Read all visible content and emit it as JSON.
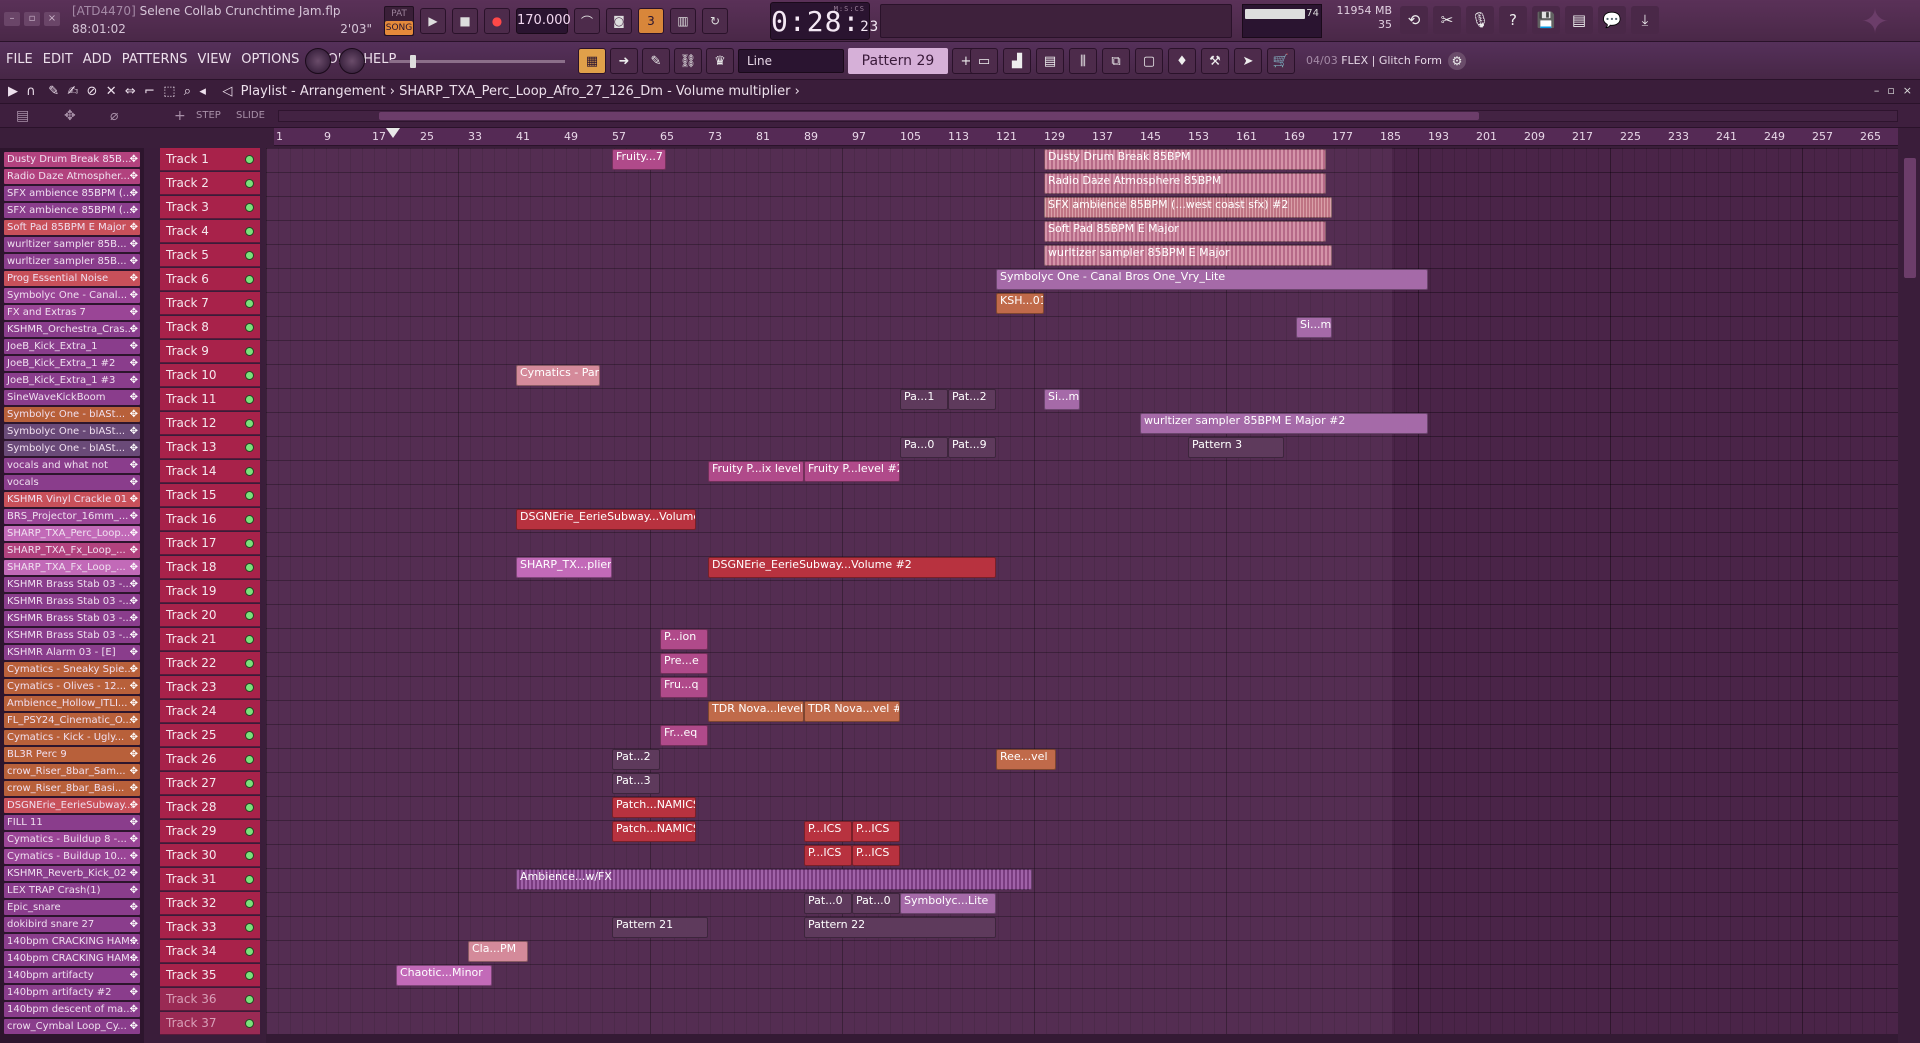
{
  "window": {
    "tag": "[ATD4470]",
    "filename": "Selene Collab Crunchtime Jam.flp",
    "position": "88:01:02",
    "duration": "2'03\""
  },
  "transport": {
    "pat_label": "PAT",
    "song_label": "SONG",
    "tempo": "170.000",
    "time_main": "0:28",
    "time_sub": "23",
    "time_unit": "M:S:CS"
  },
  "status": {
    "meter_value": "74",
    "memory": "11954 MB",
    "cpu_count": "35"
  },
  "menu": [
    "FILE",
    "EDIT",
    "ADD",
    "PATTERNS",
    "VIEW",
    "OPTIONS",
    "TOOLS",
    "HELP"
  ],
  "snap": "Line",
  "pattern": "Pattern 29",
  "hint": {
    "counter": "04/03",
    "text": "FLEX | Glitch Form"
  },
  "playlist": {
    "title": "Playlist - Arrangement",
    "sep": "›",
    "clip": "SHARP_TXA_Perc_Loop_Afro_27_126_Dm - Volume multiplier"
  },
  "ruler": [
    "1",
    "9",
    "17",
    "25",
    "33",
    "41",
    "49",
    "57",
    "65",
    "73",
    "81",
    "89",
    "97",
    "105",
    "113",
    "121",
    "129",
    "137",
    "145",
    "153",
    "161",
    "169",
    "177",
    "185",
    "193",
    "201",
    "209",
    "217",
    "225",
    "233",
    "241",
    "249",
    "257",
    "265"
  ],
  "step_label": "STEP",
  "slide_label": "SLIDE",
  "channels": [
    {
      "name": "Dusty Drum Break 85B...",
      "color": "#b2427e"
    },
    {
      "name": "Radio Daze Atmospher...",
      "color": "#b2427e"
    },
    {
      "name": "SFX ambience 85BPM (...",
      "color": "#8a3d8c"
    },
    {
      "name": "SFX ambience 85BPM (...",
      "color": "#8a3d8c"
    },
    {
      "name": "Soft Pad 85BPM E Major",
      "color": "#c8505a"
    },
    {
      "name": "wurltizer sampler 85B...",
      "color": "#8a3d8c"
    },
    {
      "name": "wurltizer sampler 85B...",
      "color": "#8a3d8c"
    },
    {
      "name": "Prog Essential Noise",
      "color": "#c8505a"
    },
    {
      "name": "Symbolyc One - Canal...",
      "color": "#9a4596"
    },
    {
      "name": "FX and Extras 7",
      "color": "#9a4596"
    },
    {
      "name": "KSHMR_Orchestra_Cras...",
      "color": "#8a3d8c"
    },
    {
      "name": "JoeB_Kick_Extra_1",
      "color": "#8a3d8c"
    },
    {
      "name": "JoeB_Kick_Extra_1 #2",
      "color": "#8a3d8c"
    },
    {
      "name": "JoeB_Kick_Extra_1 #3",
      "color": "#8a3d8c"
    },
    {
      "name": "SineWaveKickBoom",
      "color": "#8a3d8c"
    },
    {
      "name": "Symbolyc One - bIASt...",
      "color": "#b8603a"
    },
    {
      "name": "Symbolyc One - bIASt...",
      "color": "#6a4a78"
    },
    {
      "name": "Symbolyc One - bIASt...",
      "color": "#6a4a78"
    },
    {
      "name": "vocals and what not",
      "color": "#8a3d8c"
    },
    {
      "name": "vocals",
      "color": "#8a3d8c"
    },
    {
      "name": "KSHMR Vinyl Crackle 01",
      "color": "#c8505a"
    },
    {
      "name": "BRS_Projector_16mm_...",
      "color": "#9a4596"
    },
    {
      "name": "SHARP_TXA_Perc_Loop...",
      "color": "#c26ab8"
    },
    {
      "name": "SHARP_TXA_Fx_Loop_...",
      "color": "#b2427e"
    },
    {
      "name": "SHARP_TXA_Fx_Loop_...",
      "color": "#c26ab8"
    },
    {
      "name": "KSHMR Brass Stab 03 -...",
      "color": "#8a3d8c"
    },
    {
      "name": "KSHMR Brass Stab 03 -...",
      "color": "#8a3d8c"
    },
    {
      "name": "KSHMR Brass Stab 03 -...",
      "color": "#8a3d8c"
    },
    {
      "name": "KSHMR Brass Stab 03 -...",
      "color": "#8a3d8c"
    },
    {
      "name": "KSHMR Alarm 03 - [E]",
      "color": "#8a3d8c"
    },
    {
      "name": "Cymatics - Sneaky Spie...",
      "color": "#b8603a"
    },
    {
      "name": "Cymatics - Olives - 12...",
      "color": "#b8603a"
    },
    {
      "name": "Ambience_Hollow_ITLI...",
      "color": "#b8603a"
    },
    {
      "name": "FL_PSY24_Cinematic_O...",
      "color": "#b8603a"
    },
    {
      "name": "Cymatics - Kick - Ugly...",
      "color": "#b8603a"
    },
    {
      "name": "BL3R Perc 9",
      "color": "#b8603a"
    },
    {
      "name": "crow_Riser_8bar_Sam...",
      "color": "#b8603a"
    },
    {
      "name": "crow_Riser_8bar_Basi...",
      "color": "#b8603a"
    },
    {
      "name": "DSGNErie_EerieSubway...",
      "color": "#c8505a"
    },
    {
      "name": "FILL 11",
      "color": "#8a3d8c"
    },
    {
      "name": "Cymatics - Buildup 8 -...",
      "color": "#9a4596"
    },
    {
      "name": "Cymatics - Buildup 10...",
      "color": "#9a4596"
    },
    {
      "name": "KSHMR_Reverb_Kick_02",
      "color": "#8a3d8c"
    },
    {
      "name": "LEX TRAP Crash(1)",
      "color": "#8a3d8c"
    },
    {
      "name": "Epic_snare",
      "color": "#8a3d8c"
    },
    {
      "name": "dokibird snare 27",
      "color": "#8a3d8c"
    },
    {
      "name": "140bpm CRACKING HAM...",
      "color": "#8a3d8c"
    },
    {
      "name": "140bpm CRACKING HAM...",
      "color": "#8a3d8c"
    },
    {
      "name": "140bpm artifacty",
      "color": "#8a3d8c"
    },
    {
      "name": "140bpm artifacty #2",
      "color": "#8a3d8c"
    },
    {
      "name": "140bpm descent of ma...",
      "color": "#8a3d8c"
    },
    {
      "name": "crow_Cymbal Loop_Cy...",
      "color": "#8a3d8c"
    }
  ],
  "tracks": [
    "Track 1",
    "Track 2",
    "Track 3",
    "Track 4",
    "Track 5",
    "Track 6",
    "Track 7",
    "Track 8",
    "Track 9",
    "Track 10",
    "Track 11",
    "Track 12",
    "Track 13",
    "Track 14",
    "Track 15",
    "Track 16",
    "Track 17",
    "Track 18",
    "Track 19",
    "Track 20",
    "Track 21",
    "Track 22",
    "Track 23",
    "Track 24",
    "Track 25",
    "Track 26",
    "Track 27",
    "Track 28",
    "Track 29",
    "Track 30",
    "Track 31",
    "Track 32",
    "Track 33",
    "Track 34",
    "Track 35",
    "Track 36",
    "Track 37"
  ],
  "clips": [
    {
      "track": 0,
      "bar": 57,
      "len": 9,
      "label": "Fruity...7 freq",
      "kind": "auto"
    },
    {
      "track": 0,
      "bar": 129,
      "len": 47,
      "label": "Dusty Drum Break 85BPM",
      "kind": "wave"
    },
    {
      "track": 1,
      "bar": 129,
      "len": 47,
      "label": "Radio Daze Atmosphere 85BPM",
      "kind": "wave"
    },
    {
      "track": 2,
      "bar": 129,
      "len": 48,
      "label": "SFX ambience 85BPM (...west coast sfx) #2",
      "kind": "wave2"
    },
    {
      "track": 3,
      "bar": 129,
      "len": 47,
      "label": "Soft Pad 85BPM E Major",
      "kind": "wave"
    },
    {
      "track": 4,
      "bar": 129,
      "len": 48,
      "label": "wurltizer sampler 85BPM E Major",
      "kind": "wave"
    },
    {
      "track": 5,
      "bar": 121,
      "len": 72,
      "label": "Symbolyc One - Canal Bros One_Vry_Lite",
      "kind": "lav"
    },
    {
      "track": 6,
      "bar": 121,
      "len": 8,
      "label": "KSH...01",
      "kind": "orange"
    },
    {
      "track": 7,
      "bar": 171,
      "len": 6,
      "label": "Si...m",
      "kind": "lav"
    },
    {
      "track": 9,
      "bar": 41,
      "len": 14,
      "label": "Cymatics - Parts",
      "kind": "rose"
    },
    {
      "track": 10,
      "bar": 129,
      "len": 6,
      "label": "Si...m",
      "kind": "lav"
    },
    {
      "track": 10,
      "bar": 105,
      "len": 8,
      "label": "Pa...1",
      "kind": "pat"
    },
    {
      "track": 10,
      "bar": 113,
      "len": 8,
      "label": "Pat...2",
      "kind": "pat"
    },
    {
      "track": 11,
      "bar": 145,
      "len": 48,
      "label": "wurltizer sampler 85BPM E Major #2",
      "kind": "lav"
    },
    {
      "track": 12,
      "bar": 153,
      "len": 16,
      "label": "Pattern 3",
      "kind": "pat"
    },
    {
      "track": 12,
      "bar": 105,
      "len": 8,
      "label": "Pa...0",
      "kind": "pat"
    },
    {
      "track": 12,
      "bar": 113,
      "len": 8,
      "label": "Pat...9",
      "kind": "pat"
    },
    {
      "track": 13,
      "bar": 73,
      "len": 16,
      "label": "Fruity P...ix level",
      "kind": "auto"
    },
    {
      "track": 13,
      "bar": 89,
      "len": 16,
      "label": "Fruity P...level #2",
      "kind": "auto"
    },
    {
      "track": 15,
      "bar": 41,
      "len": 30,
      "label": "DSGNErie_EerieSubway...Volume",
      "kind": "red"
    },
    {
      "track": 17,
      "bar": 41,
      "len": 16,
      "label": "SHARP_TX...plier",
      "kind": "pink"
    },
    {
      "track": 17,
      "bar": 73,
      "len": 48,
      "label": "DSGNErie_EerieSubway...Volume #2",
      "kind": "red"
    },
    {
      "track": 20,
      "bar": 65,
      "len": 8,
      "label": "P...ion",
      "kind": "auto"
    },
    {
      "track": 21,
      "bar": 65,
      "len": 8,
      "label": "Pre...e",
      "kind": "auto"
    },
    {
      "track": 22,
      "bar": 65,
      "len": 8,
      "label": "Fru...q",
      "kind": "auto"
    },
    {
      "track": 23,
      "bar": 73,
      "len": 16,
      "label": "TDR Nova...level",
      "kind": "orange"
    },
    {
      "track": 23,
      "bar": 89,
      "len": 16,
      "label": "TDR Nova...vel #2",
      "kind": "orange"
    },
    {
      "track": 24,
      "bar": 65,
      "len": 8,
      "label": "Fr...eq",
      "kind": "auto"
    },
    {
      "track": 25,
      "bar": 57,
      "len": 8,
      "label": "Pat...2",
      "kind": "pat"
    },
    {
      "track": 25,
      "bar": 121,
      "len": 10,
      "label": "Ree...vel",
      "kind": "orange"
    },
    {
      "track": 26,
      "bar": 57,
      "len": 8,
      "label": "Pat...3",
      "kind": "pat"
    },
    {
      "track": 27,
      "bar": 57,
      "len": 14,
      "label": "Patch...NAMICS",
      "kind": "red"
    },
    {
      "track": 28,
      "bar": 57,
      "len": 14,
      "label": "Patch...NAMICS",
      "kind": "red"
    },
    {
      "track": 28,
      "bar": 89,
      "len": 8,
      "label": "P...ICS",
      "kind": "red"
    },
    {
      "track": 28,
      "bar": 97,
      "len": 8,
      "label": "P...ICS",
      "kind": "red"
    },
    {
      "track": 29,
      "bar": 89,
      "len": 8,
      "label": "P...ICS",
      "kind": "red"
    },
    {
      "track": 29,
      "bar": 97,
      "len": 8,
      "label": "P...ICS",
      "kind": "red"
    },
    {
      "track": 30,
      "bar": 41,
      "len": 86,
      "label": "Ambience...w/FX",
      "kind": "pur"
    },
    {
      "track": 31,
      "bar": 89,
      "len": 8,
      "label": "Pat...0",
      "kind": "pat"
    },
    {
      "track": 31,
      "bar": 97,
      "len": 8,
      "label": "Pat...0",
      "kind": "pat"
    },
    {
      "track": 31,
      "bar": 105,
      "len": 16,
      "label": "Symbolyc...Lite",
      "kind": "lav"
    },
    {
      "track": 32,
      "bar": 57,
      "len": 16,
      "label": "Pattern 21",
      "kind": "pat"
    },
    {
      "track": 32,
      "bar": 89,
      "len": 32,
      "label": "Pattern 22",
      "kind": "pat"
    },
    {
      "track": 33,
      "bar": 33,
      "len": 10,
      "label": "Cla...PM",
      "kind": "rose"
    },
    {
      "track": 34,
      "bar": 21,
      "len": 16,
      "label": "Chaotic...Minor",
      "kind": "pink"
    }
  ]
}
